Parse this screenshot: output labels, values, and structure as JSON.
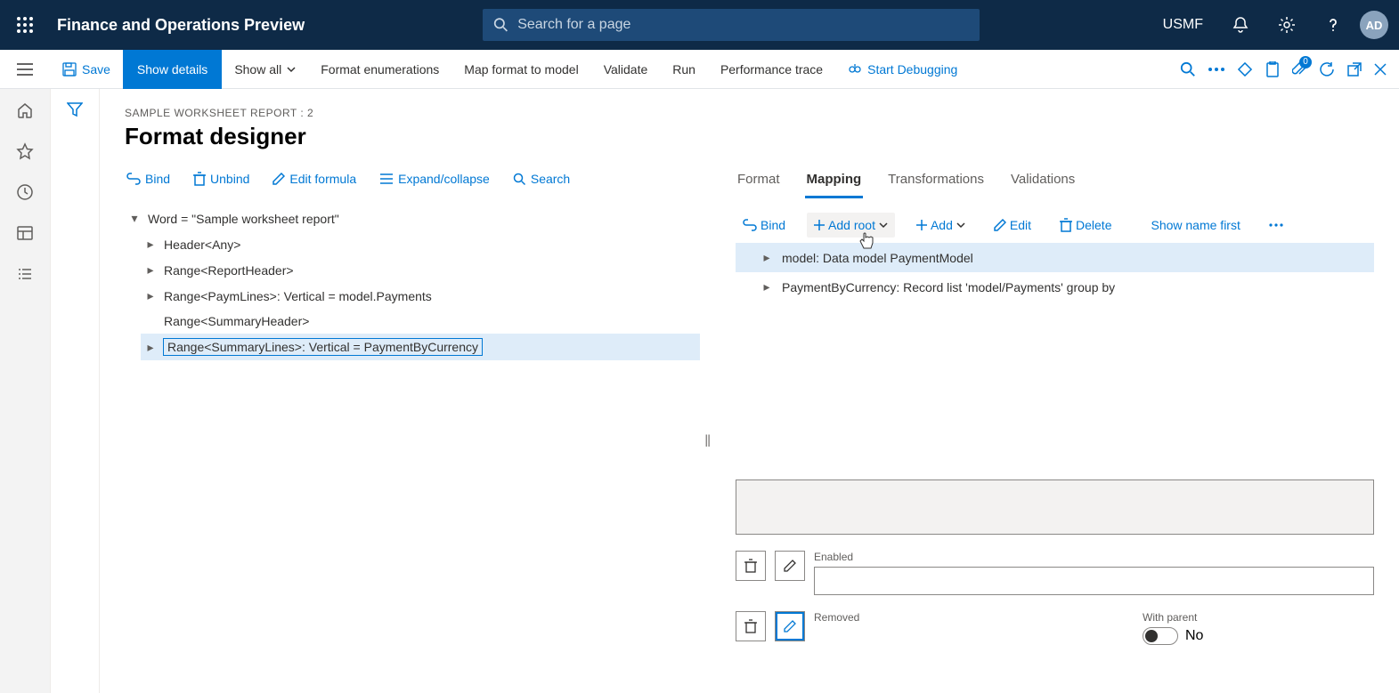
{
  "header": {
    "title": "Finance and Operations Preview",
    "search_placeholder": "Search for a page",
    "company": "USMF",
    "user_initials": "AD"
  },
  "action_bar": {
    "save": "Save",
    "show_details": "Show details",
    "show_all": "Show all",
    "format_enum": "Format enumerations",
    "map_format": "Map format to model",
    "validate": "Validate",
    "run": "Run",
    "perf_trace": "Performance trace",
    "start_debug": "Start Debugging",
    "badge_count": "0"
  },
  "page": {
    "breadcrumb": "SAMPLE WORKSHEET REPORT : 2",
    "title": "Format designer"
  },
  "left_toolbar": {
    "bind": "Bind",
    "unbind": "Unbind",
    "edit_formula": "Edit formula",
    "expand": "Expand/collapse",
    "search": "Search"
  },
  "tree": {
    "root": "Word = \"Sample worksheet report\"",
    "items": [
      "Header<Any>",
      "Range<ReportHeader>",
      "Range<PaymLines>: Vertical = model.Payments",
      "Range<SummaryHeader>",
      "Range<SummaryLines>: Vertical = PaymentByCurrency"
    ]
  },
  "right_tabs": {
    "format": "Format",
    "mapping": "Mapping",
    "transformations": "Transformations",
    "validations": "Validations"
  },
  "right_toolbar": {
    "bind": "Bind",
    "add_root": "Add root",
    "add": "Add",
    "edit": "Edit",
    "delete": "Delete",
    "show_name": "Show name first"
  },
  "datasources": {
    "items": [
      "model: Data model PaymentModel",
      "PaymentByCurrency: Record list 'model/Payments' group by"
    ]
  },
  "properties": {
    "enabled_label": "Enabled",
    "removed_label": "Removed",
    "with_parent_label": "With parent",
    "with_parent_value": "No"
  }
}
